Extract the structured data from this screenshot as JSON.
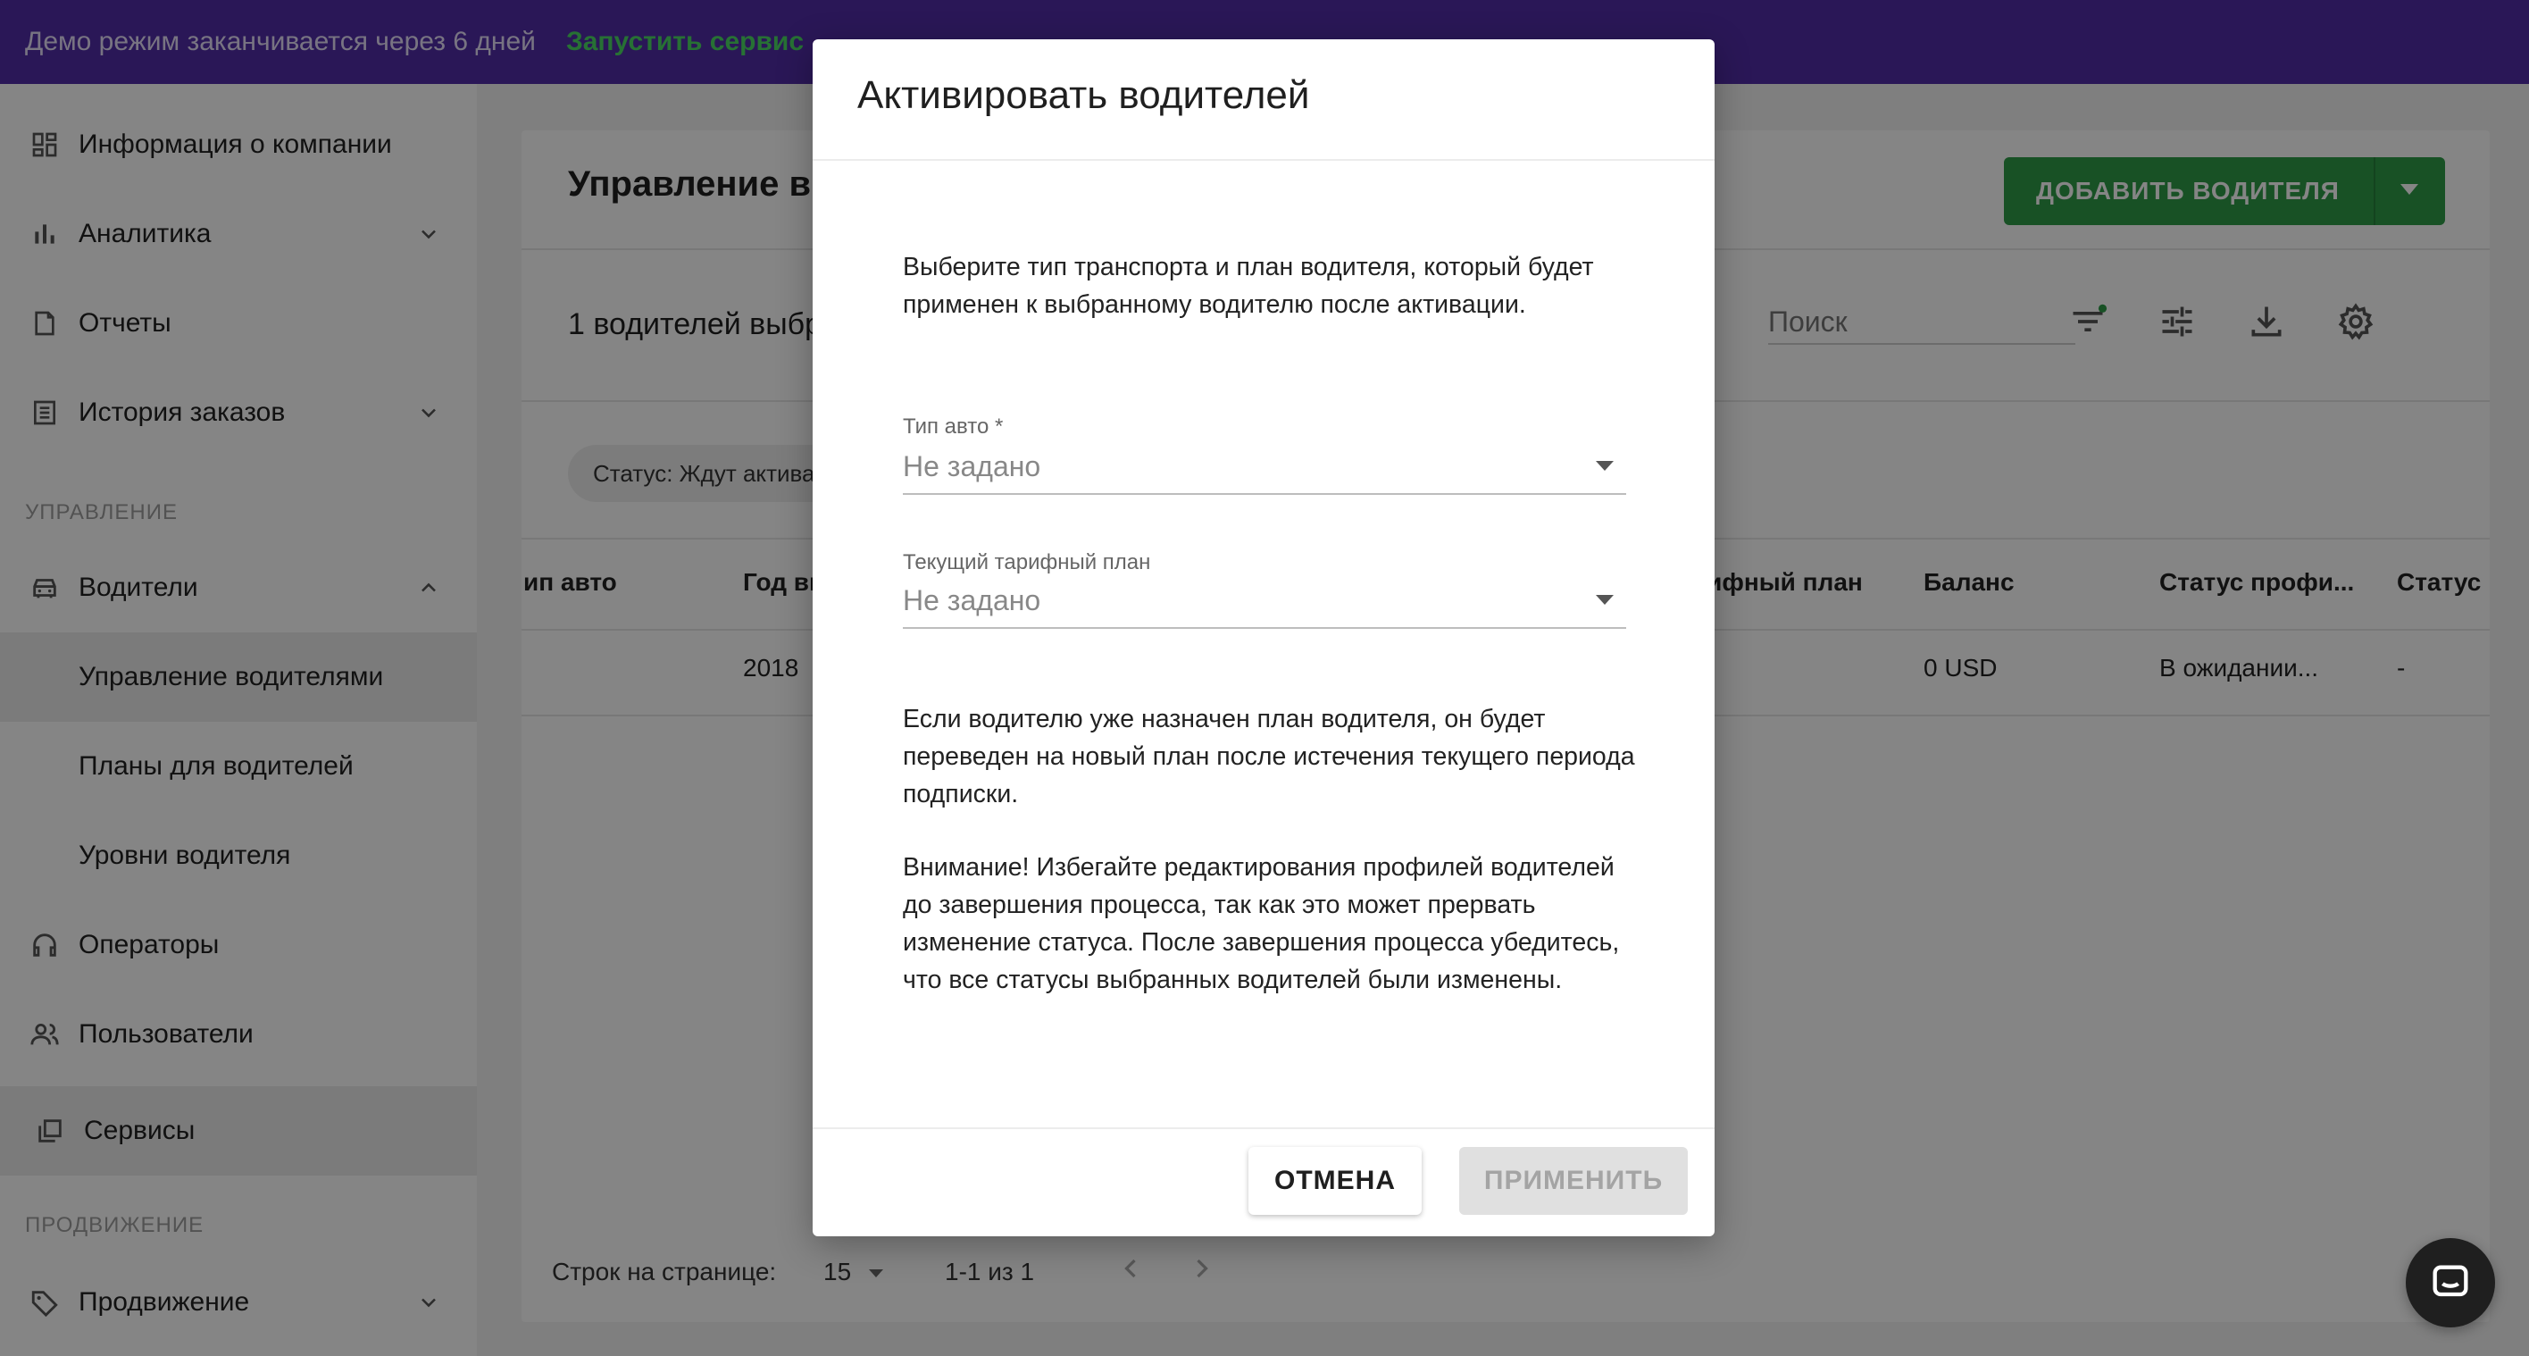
{
  "banner": {
    "message": "Демо режим заканчивается через 6 дней",
    "link": "Запустить сервис"
  },
  "sidebar": {
    "items": [
      {
        "label": "Информация о компании",
        "icon": "dashboard-icon"
      },
      {
        "label": "Аналитика",
        "icon": "bar-chart-icon"
      },
      {
        "label": "Отчеты",
        "icon": "report-icon"
      },
      {
        "label": "История заказов",
        "icon": "list-icon"
      },
      {
        "label": "Водители",
        "icon": "car-icon"
      },
      {
        "label": "Управление водителями"
      },
      {
        "label": "Планы для водителей"
      },
      {
        "label": "Уровни водителя"
      },
      {
        "label": "Операторы",
        "icon": "headset-icon"
      },
      {
        "label": "Пользователи",
        "icon": "users-icon"
      },
      {
        "label": "Сервисы",
        "icon": "services-icon"
      },
      {
        "label": "Продвижение",
        "icon": "tag-icon"
      }
    ],
    "section_manage": "УПРАВЛЕНИЕ",
    "section_promo": "ПРОДВИЖЕНИЕ"
  },
  "main": {
    "title": "Управление в",
    "add_button": "ДОБАВИТЬ ВОДИТЕЛЯ",
    "selected_count": "1 водителей выбр",
    "search_placeholder": "Поиск",
    "chip": "Статус: Ждут актива",
    "columns": [
      "ип авто",
      "Год вы",
      "рифный план",
      "Баланс",
      "Статус профи...",
      "Статус"
    ],
    "row": {
      "year": "2018",
      "balance": "0 USD",
      "profile_status": "В ожидании...",
      "status": "-"
    },
    "pager": {
      "rows_label": "Строк на странице:",
      "rows_value": "15",
      "range": "1-1 из 1"
    }
  },
  "modal": {
    "title": "Активировать водителей",
    "intro": "Выберите тип транспорта и план водителя, который будет применен к выбранному водителю после активации.",
    "car_type_label": "Тип авто *",
    "car_type_value": "Не задано",
    "plan_label": "Текущий тарифный план",
    "plan_value": "Не задано",
    "note1": "Если водителю уже назначен план водителя, он будет переведен на новый план после истечения текущего периода подписки.",
    "note2": "Внимание! Избегайте редактирования профилей водителей до завершения процесса, так как это может прервать изменение статуса. После завершения процесса убедитесь, что все статусы выбранных водителей были изменены.",
    "cancel": "ОТМЕНА",
    "apply": "ПРИМЕНИТЬ"
  },
  "colors": {
    "banner": "#512da8",
    "link": "#4cd964",
    "primary": "#2e9b47"
  }
}
